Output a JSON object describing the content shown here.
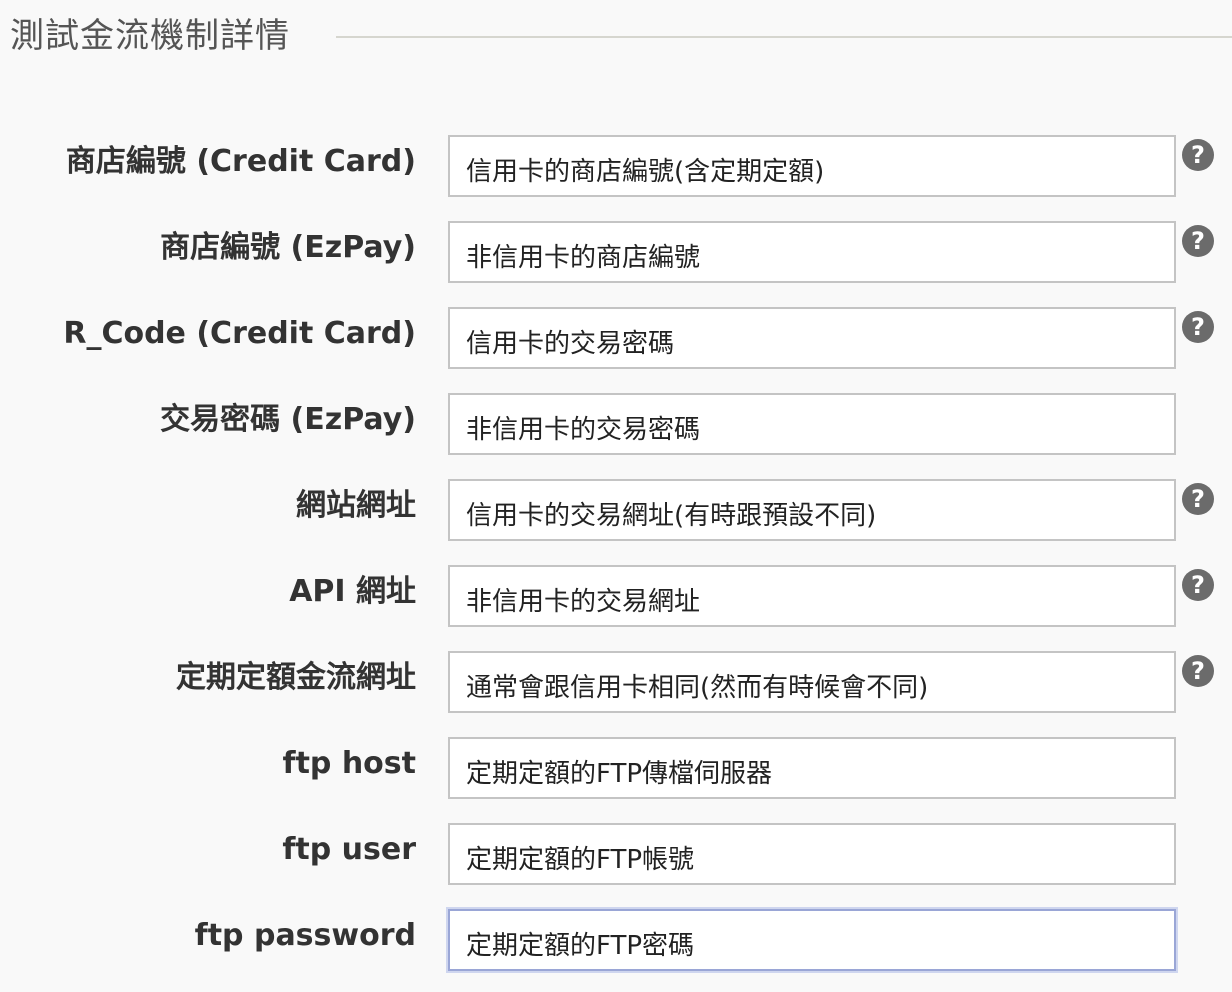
{
  "section": {
    "title": "測試金流機制詳情"
  },
  "icons": {
    "help": "question-circle-icon",
    "help_glyph": "?"
  },
  "colors": {
    "background": "#f9f9f9",
    "input_border": "#c4c4c4",
    "input_focus_border": "#9aa6d6",
    "help_icon": "#6b6b6b"
  },
  "fields": [
    {
      "label": "商店編號 (Credit Card)",
      "value": "信用卡的商店編號(含定期定額)",
      "help": true
    },
    {
      "label": "商店編號 (EzPay)",
      "value": "非信用卡的商店編號",
      "help": true
    },
    {
      "label": "R_Code (Credit Card)",
      "value": "信用卡的交易密碼",
      "help": true
    },
    {
      "label": "交易密碼 (EzPay)",
      "value": "非信用卡的交易密碼",
      "help": false
    },
    {
      "label": "網站網址",
      "value": "信用卡的交易網址(有時跟預設不同)",
      "help": true
    },
    {
      "label": "API 網址",
      "value": "非信用卡的交易網址",
      "help": true
    },
    {
      "label": "定期定額金流網址",
      "value": "通常會跟信用卡相同(然而有時候會不同)",
      "help": true
    },
    {
      "label": "ftp host",
      "value": "定期定額的FTP傳檔伺服器",
      "help": false
    },
    {
      "label": "ftp user",
      "value": "定期定額的FTP帳號",
      "help": false
    },
    {
      "label": "ftp password",
      "value": "定期定額的FTP密碼",
      "help": false,
      "focused": true
    }
  ]
}
